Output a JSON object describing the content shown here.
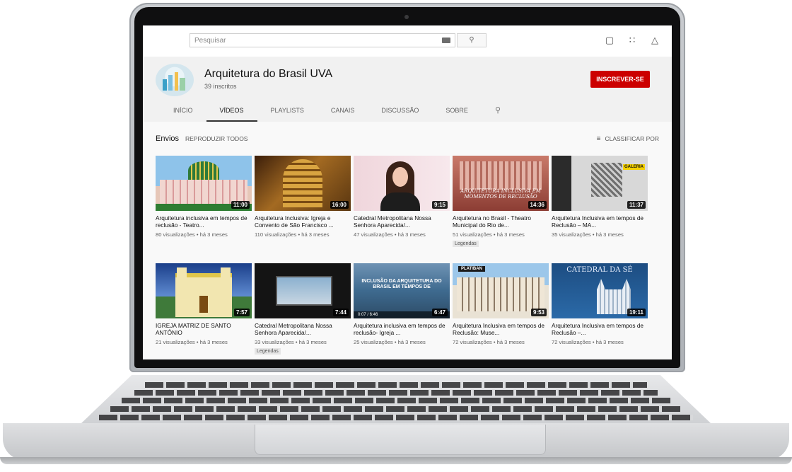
{
  "search": {
    "placeholder": "Pesquisar"
  },
  "topbar": {
    "icons": [
      "camera-add-icon",
      "apps-grid-icon",
      "bell-icon"
    ]
  },
  "channel": {
    "name": "Arquitetura do Brasil UVA",
    "subscribers": "39 inscritos",
    "subscribe_label": "INSCREVER-SE"
  },
  "tabs": [
    "INÍCIO",
    "VÍDEOS",
    "PLAYLISTS",
    "CANAIS",
    "DISCUSSÃO",
    "SOBRE"
  ],
  "section": {
    "title": "Envios",
    "play_all": "REPRODUZIR TODOS",
    "sort": "CLASSIFICAR POR"
  },
  "videos": [
    {
      "title": "Arquitetura inclusiva em tempos de reclusão - Teatro...",
      "duration": "11:00",
      "meta": "80 visualizações • há 3 meses",
      "badge": ""
    },
    {
      "title": "Arquitetura Inclusiva: Igreja e Convento de São Francisco ...",
      "duration": "16:00",
      "meta": "110 visualizações • há 3 meses",
      "badge": ""
    },
    {
      "title": "Catedral Metropolitana Nossa Senhora Aparecida/...",
      "duration": "9:15",
      "meta": "47 visualizações • há 3 meses",
      "badge": ""
    },
    {
      "title": "Arquitetura no Brasil - Theatro Municipal do Rio de...",
      "duration": "14:36",
      "meta": "51 visualizações • há 3 meses",
      "badge": "Legendas",
      "thumb_text": "ARQUITETURA INCLUSIVA EM MOMENTOS DE RECLUSÃO"
    },
    {
      "title": "Arquitetura Inclusiva em tempos de Reclusão – MA...",
      "duration": "11:37",
      "meta": "35 visualizações • há 3 meses",
      "badge": "",
      "thumb_text": "GALERIA"
    },
    {
      "title": "IGREJA MATRIZ DE SANTO ANTÔNIO",
      "duration": "7:57",
      "meta": "21 visualizações • há 3 meses",
      "badge": ""
    },
    {
      "title": "Catedral Metropolitana Nossa Senhora Aparecida/...",
      "duration": "7:44",
      "meta": "33 visualizações • há 3 meses",
      "badge": "Legendas"
    },
    {
      "title": "Arquitetura inclusiva em tempos de reclusão- Igreja ...",
      "duration": "6:47",
      "meta": "25 visualizações • há 3 meses",
      "badge": "",
      "thumb_text": "INCLUSÃO DA ARQUITETURA DO BRASIL EM TEMPOS DE",
      "player_time": "0:07 / 6:46"
    },
    {
      "title": "Arquitetura Inclusiva em tempos de Reclusão: Muse...",
      "duration": "9:53",
      "meta": "72 visualizações • há 3 meses",
      "badge": "",
      "thumb_text": "PLATIBAN"
    },
    {
      "title": "Arquitetura Inclusiva em tempos de Reclusão –...",
      "duration": "19:11",
      "meta": "72 visualizações • há 3 meses",
      "badge": "",
      "thumb_text": "CATEDRAL DA SÉ"
    }
  ]
}
